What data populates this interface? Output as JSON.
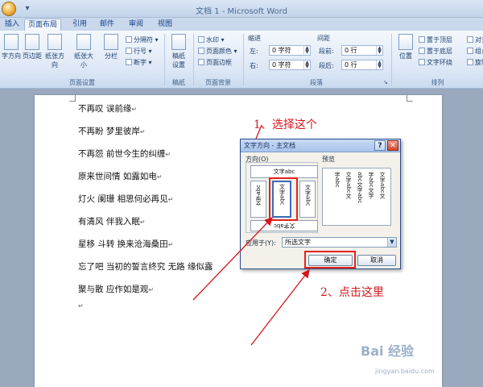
{
  "window": {
    "title": "文档 1 - Microsoft Word"
  },
  "tabs": [
    "插入",
    "页面布局",
    "引用",
    "邮件",
    "审阅",
    "视图"
  ],
  "active_tab": "页面布局",
  "ribbon": {
    "page_setup": {
      "buttons": [
        "字方向",
        "页边距",
        "纸张方向",
        "纸张大小",
        "分栏"
      ],
      "small": [
        "分隔符",
        "行号",
        "断字"
      ],
      "label": "页面设置"
    },
    "manuscript": {
      "button": [
        "稿纸",
        "设置"
      ],
      "label": "稿纸"
    },
    "background": {
      "items": [
        "水印",
        "页面颜色",
        "页面边框"
      ],
      "label": "页面背景"
    },
    "paragraph": {
      "indent_label": "缩进",
      "spacing_label": "间距",
      "left_label": "左:",
      "left_value": "0 字符",
      "right_label": "右:",
      "right_value": "0 字符",
      "before_label": "段前:",
      "before_value": "0 行",
      "after_label": "段后:",
      "after_value": "0 行",
      "label": "段落"
    },
    "arrange": {
      "position": "位置",
      "items": [
        "置于顶层",
        "置于底层",
        "文字环绕"
      ],
      "items_right": [
        "对齐",
        "组合",
        "旋转"
      ],
      "label": "排列"
    }
  },
  "document": {
    "lines": [
      "不再叹 误前缘",
      "不再盼 梦里彼岸",
      "不再怨 前世今生的纠缠",
      "原来世间情 如露如电",
      "灯火 阑珊 相思何必再见",
      "有清风 伴我入眠",
      "星移 斗转 换来沧海桑田",
      "忘了吧 当初的誓言终究 无路 缘似露",
      "聚与散 应作如是观"
    ],
    "paragraph_mark": "↵"
  },
  "dialog": {
    "title": "文字方向 - 主文档",
    "orientation_label": "方向(O)",
    "preview_label": "预览",
    "options": [
      "文字abc",
      "文字abc",
      "文字abc",
      "文字abc",
      "文字abc"
    ],
    "preview_columns": [
      "文字abc文",
      "字abc文字",
      "abc文字abc",
      "文字abc文",
      "字abc"
    ],
    "apply_to_label": "应用于(Y):",
    "apply_to_value": "所选文字",
    "ok": "确定",
    "cancel": "取消"
  },
  "annotations": {
    "step1": "1、选择这个",
    "step2": "2、点击这里",
    "color": "#d4161b"
  },
  "watermark": {
    "text": "Bai 经验",
    "sub": "jingyan.baidu.com"
  }
}
